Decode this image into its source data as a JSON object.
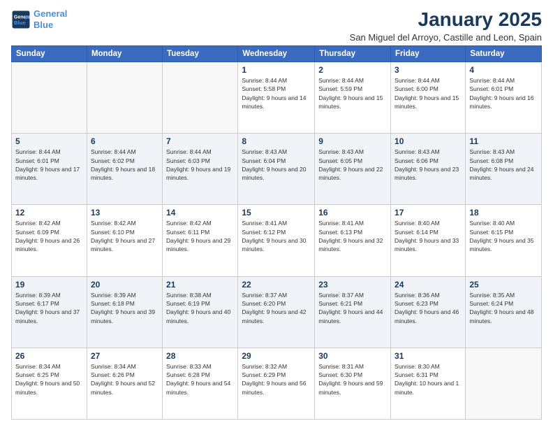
{
  "header": {
    "logo_line1": "General",
    "logo_line2": "Blue",
    "month": "January 2025",
    "location": "San Miguel del Arroyo, Castille and Leon, Spain"
  },
  "weekdays": [
    "Sunday",
    "Monday",
    "Tuesday",
    "Wednesday",
    "Thursday",
    "Friday",
    "Saturday"
  ],
  "weeks": [
    [
      {
        "day": "",
        "text": ""
      },
      {
        "day": "",
        "text": ""
      },
      {
        "day": "",
        "text": ""
      },
      {
        "day": "1",
        "text": "Sunrise: 8:44 AM\nSunset: 5:58 PM\nDaylight: 9 hours and 14 minutes."
      },
      {
        "day": "2",
        "text": "Sunrise: 8:44 AM\nSunset: 5:59 PM\nDaylight: 9 hours and 15 minutes."
      },
      {
        "day": "3",
        "text": "Sunrise: 8:44 AM\nSunset: 6:00 PM\nDaylight: 9 hours and 15 minutes."
      },
      {
        "day": "4",
        "text": "Sunrise: 8:44 AM\nSunset: 6:01 PM\nDaylight: 9 hours and 16 minutes."
      }
    ],
    [
      {
        "day": "5",
        "text": "Sunrise: 8:44 AM\nSunset: 6:01 PM\nDaylight: 9 hours and 17 minutes."
      },
      {
        "day": "6",
        "text": "Sunrise: 8:44 AM\nSunset: 6:02 PM\nDaylight: 9 hours and 18 minutes."
      },
      {
        "day": "7",
        "text": "Sunrise: 8:44 AM\nSunset: 6:03 PM\nDaylight: 9 hours and 19 minutes."
      },
      {
        "day": "8",
        "text": "Sunrise: 8:43 AM\nSunset: 6:04 PM\nDaylight: 9 hours and 20 minutes."
      },
      {
        "day": "9",
        "text": "Sunrise: 8:43 AM\nSunset: 6:05 PM\nDaylight: 9 hours and 22 minutes."
      },
      {
        "day": "10",
        "text": "Sunrise: 8:43 AM\nSunset: 6:06 PM\nDaylight: 9 hours and 23 minutes."
      },
      {
        "day": "11",
        "text": "Sunrise: 8:43 AM\nSunset: 6:08 PM\nDaylight: 9 hours and 24 minutes."
      }
    ],
    [
      {
        "day": "12",
        "text": "Sunrise: 8:42 AM\nSunset: 6:09 PM\nDaylight: 9 hours and 26 minutes."
      },
      {
        "day": "13",
        "text": "Sunrise: 8:42 AM\nSunset: 6:10 PM\nDaylight: 9 hours and 27 minutes."
      },
      {
        "day": "14",
        "text": "Sunrise: 8:42 AM\nSunset: 6:11 PM\nDaylight: 9 hours and 29 minutes."
      },
      {
        "day": "15",
        "text": "Sunrise: 8:41 AM\nSunset: 6:12 PM\nDaylight: 9 hours and 30 minutes."
      },
      {
        "day": "16",
        "text": "Sunrise: 8:41 AM\nSunset: 6:13 PM\nDaylight: 9 hours and 32 minutes."
      },
      {
        "day": "17",
        "text": "Sunrise: 8:40 AM\nSunset: 6:14 PM\nDaylight: 9 hours and 33 minutes."
      },
      {
        "day": "18",
        "text": "Sunrise: 8:40 AM\nSunset: 6:15 PM\nDaylight: 9 hours and 35 minutes."
      }
    ],
    [
      {
        "day": "19",
        "text": "Sunrise: 8:39 AM\nSunset: 6:17 PM\nDaylight: 9 hours and 37 minutes."
      },
      {
        "day": "20",
        "text": "Sunrise: 8:39 AM\nSunset: 6:18 PM\nDaylight: 9 hours and 39 minutes."
      },
      {
        "day": "21",
        "text": "Sunrise: 8:38 AM\nSunset: 6:19 PM\nDaylight: 9 hours and 40 minutes."
      },
      {
        "day": "22",
        "text": "Sunrise: 8:37 AM\nSunset: 6:20 PM\nDaylight: 9 hours and 42 minutes."
      },
      {
        "day": "23",
        "text": "Sunrise: 8:37 AM\nSunset: 6:21 PM\nDaylight: 9 hours and 44 minutes."
      },
      {
        "day": "24",
        "text": "Sunrise: 8:36 AM\nSunset: 6:23 PM\nDaylight: 9 hours and 46 minutes."
      },
      {
        "day": "25",
        "text": "Sunrise: 8:35 AM\nSunset: 6:24 PM\nDaylight: 9 hours and 48 minutes."
      }
    ],
    [
      {
        "day": "26",
        "text": "Sunrise: 8:34 AM\nSunset: 6:25 PM\nDaylight: 9 hours and 50 minutes."
      },
      {
        "day": "27",
        "text": "Sunrise: 8:34 AM\nSunset: 6:26 PM\nDaylight: 9 hours and 52 minutes."
      },
      {
        "day": "28",
        "text": "Sunrise: 8:33 AM\nSunset: 6:28 PM\nDaylight: 9 hours and 54 minutes."
      },
      {
        "day": "29",
        "text": "Sunrise: 8:32 AM\nSunset: 6:29 PM\nDaylight: 9 hours and 56 minutes."
      },
      {
        "day": "30",
        "text": "Sunrise: 8:31 AM\nSunset: 6:30 PM\nDaylight: 9 hours and 59 minutes."
      },
      {
        "day": "31",
        "text": "Sunrise: 8:30 AM\nSunset: 6:31 PM\nDaylight: 10 hours and 1 minute."
      },
      {
        "day": "",
        "text": ""
      }
    ]
  ]
}
